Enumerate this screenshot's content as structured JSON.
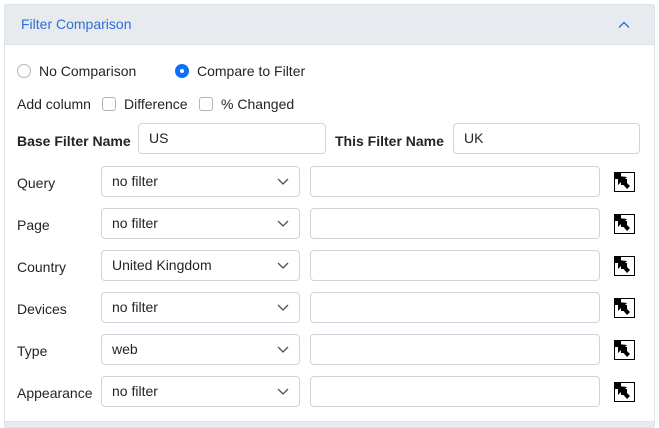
{
  "panel": {
    "title": "Filter Comparison"
  },
  "comparison_mode": {
    "options": [
      {
        "label": "No Comparison",
        "checked": false
      },
      {
        "label": "Compare to Filter",
        "checked": true
      }
    ]
  },
  "add_column": {
    "label": "Add column",
    "options": [
      {
        "label": "Difference",
        "checked": false
      },
      {
        "label": "% Changed",
        "checked": false
      }
    ]
  },
  "names": {
    "base_label": "Base Filter Name",
    "base_value": "US",
    "this_label": "This Filter Name",
    "this_value": "UK"
  },
  "filters": [
    {
      "label": "Query",
      "selected": "no filter",
      "value": ""
    },
    {
      "label": "Page",
      "selected": "no filter",
      "value": ""
    },
    {
      "label": "Country",
      "selected": "United Kingdom",
      "value": ""
    },
    {
      "label": "Devices",
      "selected": "no filter",
      "value": ""
    },
    {
      "label": "Type",
      "selected": "web",
      "value": ""
    },
    {
      "label": "Appearance",
      "selected": "no filter",
      "value": ""
    }
  ],
  "colors": {
    "accent": "#0d6efd",
    "title_link": "#2f6fd8",
    "header_bg": "#e7eaee"
  }
}
